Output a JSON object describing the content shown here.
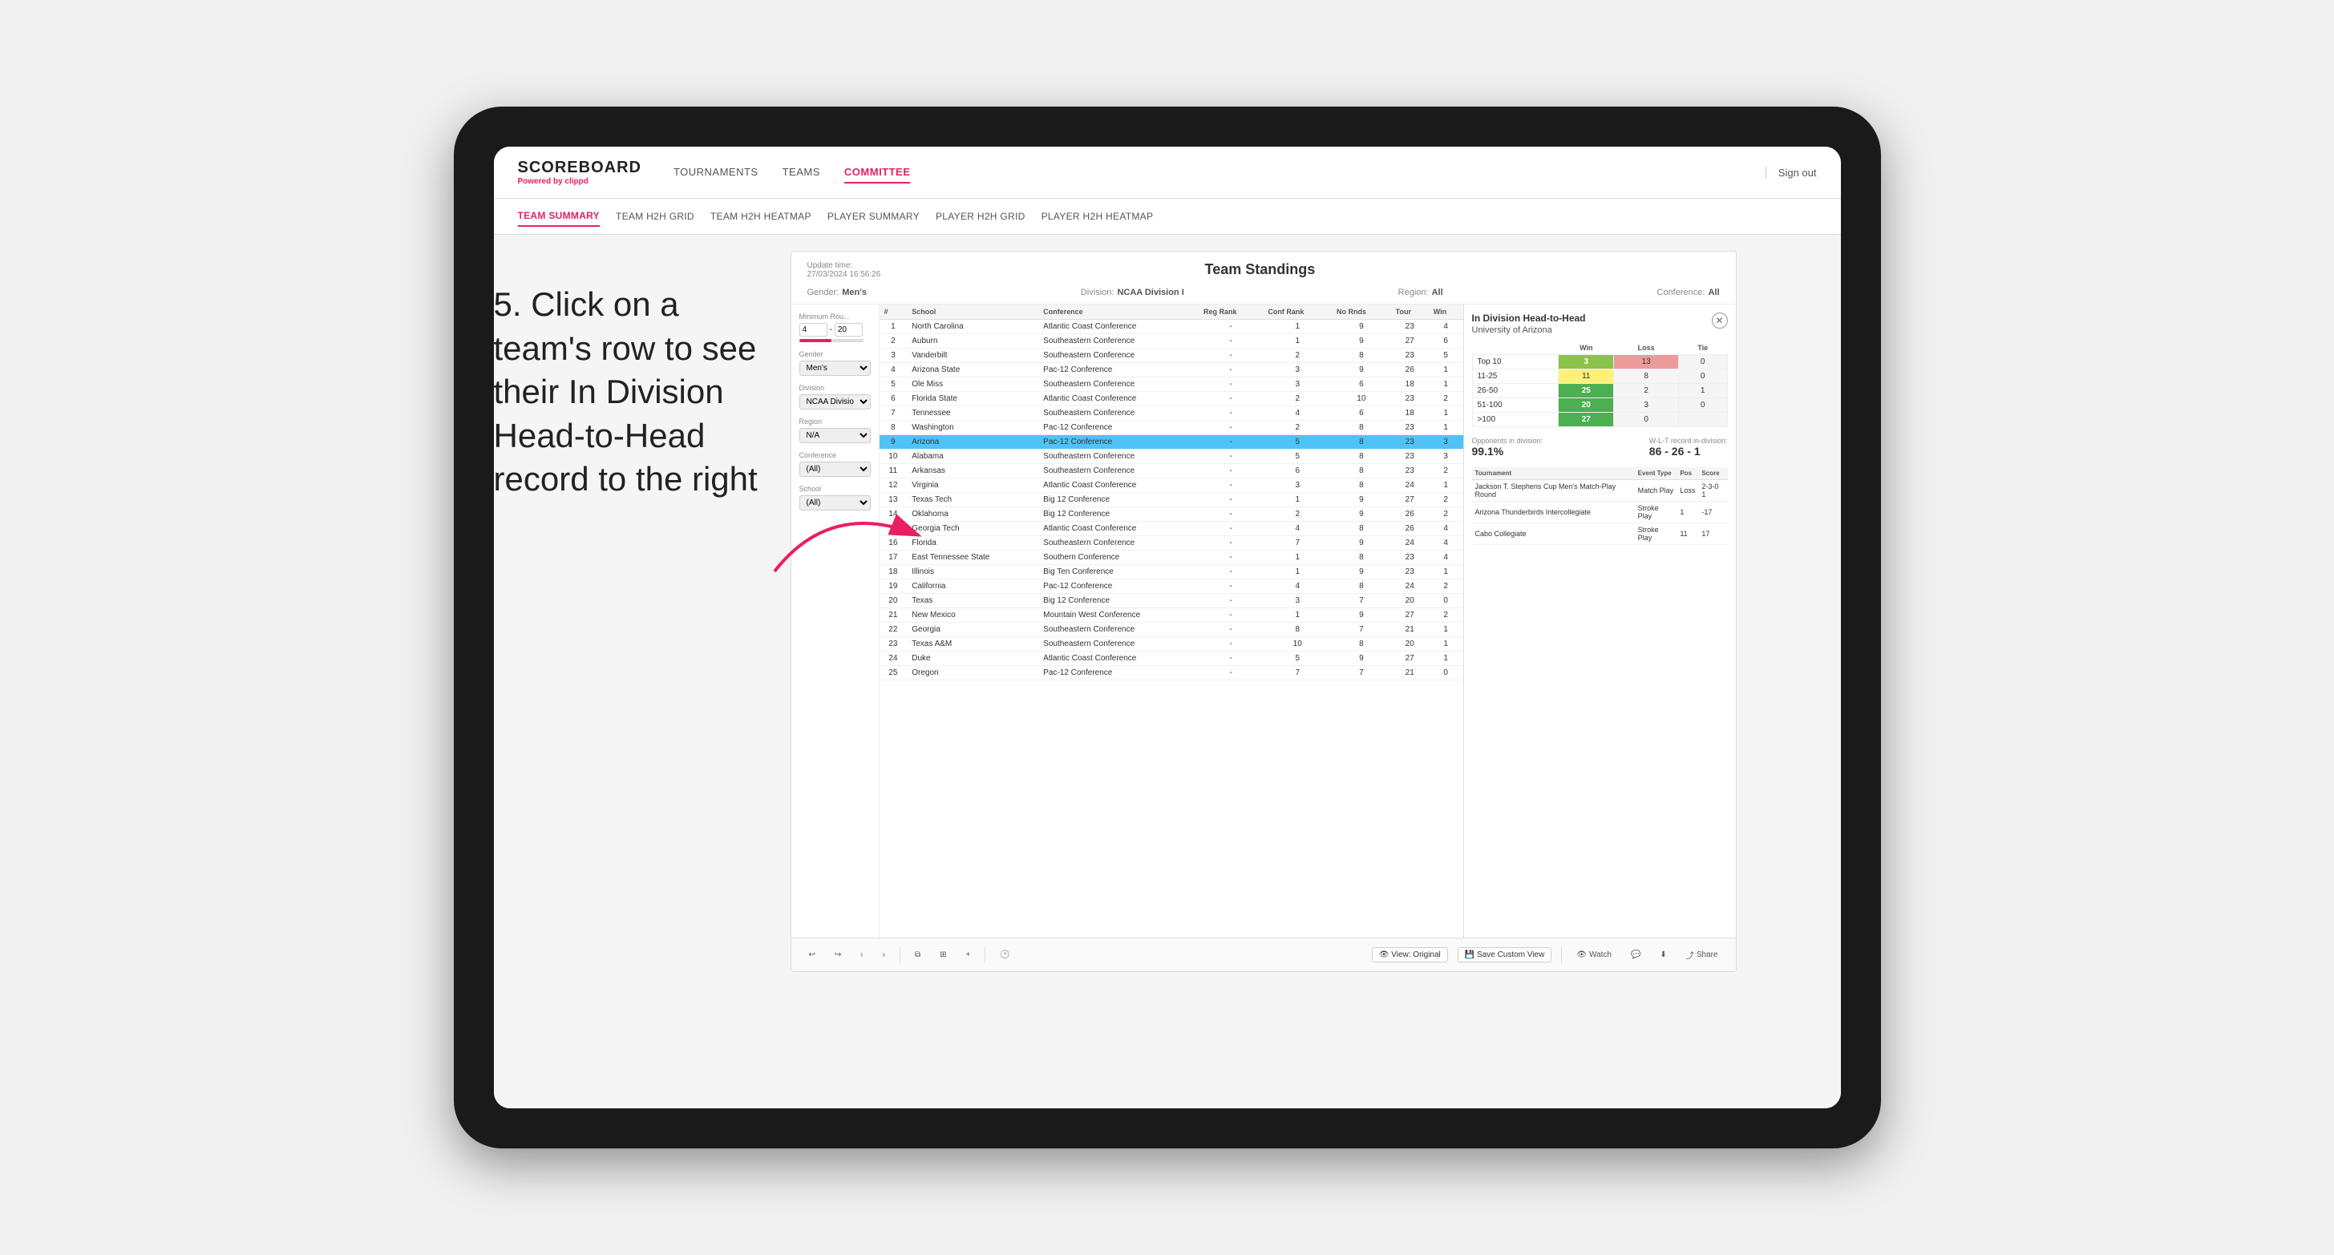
{
  "page": {
    "bg_color": "#e8e8e8"
  },
  "nav": {
    "logo": "SCOREBOARD",
    "logo_sub": "Powered by",
    "logo_brand": "clippd",
    "items": [
      {
        "label": "TOURNAMENTS",
        "active": false
      },
      {
        "label": "TEAMS",
        "active": false
      },
      {
        "label": "COMMITTEE",
        "active": true
      }
    ],
    "sign_out": "Sign out"
  },
  "sub_nav": {
    "items": [
      {
        "label": "TEAM SUMMARY",
        "active": true
      },
      {
        "label": "TEAM H2H GRID",
        "active": false
      },
      {
        "label": "TEAM H2H HEATMAP",
        "active": false
      },
      {
        "label": "PLAYER SUMMARY",
        "active": false
      },
      {
        "label": "PLAYER H2H GRID",
        "active": false
      },
      {
        "label": "PLAYER H2H HEATMAP",
        "active": false
      }
    ]
  },
  "instruction": {
    "text": "5. Click on a team's row to see their In Division Head-to-Head record to the right"
  },
  "dashboard": {
    "update_time_label": "Update time:",
    "update_time": "27/03/2024 16:56:26",
    "title": "Team Standings",
    "meta": {
      "gender_label": "Gender:",
      "gender": "Men's",
      "division_label": "Division:",
      "division": "NCAA Division I",
      "region_label": "Region:",
      "region": "All",
      "conference_label": "Conference:",
      "conference": "All"
    },
    "filters": {
      "min_rounds_label": "Minimum Rou...",
      "min_rounds_value": "4",
      "min_rounds_max": "20",
      "gender_label": "Gender",
      "gender_value": "Men's",
      "division_label": "Division",
      "division_value": "NCAA Division I",
      "region_label": "Region",
      "region_value": "N/A",
      "conference_label": "Conference",
      "conference_value": "(All)",
      "school_label": "School",
      "school_value": "(All)"
    },
    "table": {
      "headers": [
        "#",
        "School",
        "Conference",
        "Reg Rank",
        "Conf Rank",
        "No Rnds",
        "Tour",
        "Win"
      ],
      "rows": [
        {
          "num": "1",
          "school": "North Carolina",
          "conference": "Atlantic Coast Conference",
          "reg_rank": "-",
          "conf_rank": "1",
          "no_rnds": "9",
          "tour": "23",
          "win": "4"
        },
        {
          "num": "2",
          "school": "Auburn",
          "conference": "Southeastern Conference",
          "reg_rank": "-",
          "conf_rank": "1",
          "no_rnds": "9",
          "tour": "27",
          "win": "6"
        },
        {
          "num": "3",
          "school": "Vanderbilt",
          "conference": "Southeastern Conference",
          "reg_rank": "-",
          "conf_rank": "2",
          "no_rnds": "8",
          "tour": "23",
          "win": "5"
        },
        {
          "num": "4",
          "school": "Arizona State",
          "conference": "Pac-12 Conference",
          "reg_rank": "-",
          "conf_rank": "3",
          "no_rnds": "9",
          "tour": "26",
          "win": "1"
        },
        {
          "num": "5",
          "school": "Ole Miss",
          "conference": "Southeastern Conference",
          "reg_rank": "-",
          "conf_rank": "3",
          "no_rnds": "6",
          "tour": "18",
          "win": "1"
        },
        {
          "num": "6",
          "school": "Florida State",
          "conference": "Atlantic Coast Conference",
          "reg_rank": "-",
          "conf_rank": "2",
          "no_rnds": "10",
          "tour": "23",
          "win": "2"
        },
        {
          "num": "7",
          "school": "Tennessee",
          "conference": "Southeastern Conference",
          "reg_rank": "-",
          "conf_rank": "4",
          "no_rnds": "6",
          "tour": "18",
          "win": "1"
        },
        {
          "num": "8",
          "school": "Washington",
          "conference": "Pac-12 Conference",
          "reg_rank": "-",
          "conf_rank": "2",
          "no_rnds": "8",
          "tour": "23",
          "win": "1"
        },
        {
          "num": "9",
          "school": "Arizona",
          "conference": "Pac-12 Conference",
          "reg_rank": "-",
          "conf_rank": "5",
          "no_rnds": "8",
          "tour": "23",
          "win": "3",
          "selected": true
        },
        {
          "num": "10",
          "school": "Alabama",
          "conference": "Southeastern Conference",
          "reg_rank": "-",
          "conf_rank": "5",
          "no_rnds": "8",
          "tour": "23",
          "win": "3"
        },
        {
          "num": "11",
          "school": "Arkansas",
          "conference": "Southeastern Conference",
          "reg_rank": "-",
          "conf_rank": "6",
          "no_rnds": "8",
          "tour": "23",
          "win": "2"
        },
        {
          "num": "12",
          "school": "Virginia",
          "conference": "Atlantic Coast Conference",
          "reg_rank": "-",
          "conf_rank": "3",
          "no_rnds": "8",
          "tour": "24",
          "win": "1"
        },
        {
          "num": "13",
          "school": "Texas Tech",
          "conference": "Big 12 Conference",
          "reg_rank": "-",
          "conf_rank": "1",
          "no_rnds": "9",
          "tour": "27",
          "win": "2"
        },
        {
          "num": "14",
          "school": "Oklahoma",
          "conference": "Big 12 Conference",
          "reg_rank": "-",
          "conf_rank": "2",
          "no_rnds": "9",
          "tour": "26",
          "win": "2"
        },
        {
          "num": "15",
          "school": "Georgia Tech",
          "conference": "Atlantic Coast Conference",
          "reg_rank": "-",
          "conf_rank": "4",
          "no_rnds": "8",
          "tour": "26",
          "win": "4"
        },
        {
          "num": "16",
          "school": "Florida",
          "conference": "Southeastern Conference",
          "reg_rank": "-",
          "conf_rank": "7",
          "no_rnds": "9",
          "tour": "24",
          "win": "4"
        },
        {
          "num": "17",
          "school": "East Tennessee State",
          "conference": "Southern Conference",
          "reg_rank": "-",
          "conf_rank": "1",
          "no_rnds": "8",
          "tour": "23",
          "win": "4"
        },
        {
          "num": "18",
          "school": "Illinois",
          "conference": "Big Ten Conference",
          "reg_rank": "-",
          "conf_rank": "1",
          "no_rnds": "9",
          "tour": "23",
          "win": "1"
        },
        {
          "num": "19",
          "school": "California",
          "conference": "Pac-12 Conference",
          "reg_rank": "-",
          "conf_rank": "4",
          "no_rnds": "8",
          "tour": "24",
          "win": "2"
        },
        {
          "num": "20",
          "school": "Texas",
          "conference": "Big 12 Conference",
          "reg_rank": "-",
          "conf_rank": "3",
          "no_rnds": "7",
          "tour": "20",
          "win": "0"
        },
        {
          "num": "21",
          "school": "New Mexico",
          "conference": "Mountain West Conference",
          "reg_rank": "-",
          "conf_rank": "1",
          "no_rnds": "9",
          "tour": "27",
          "win": "2"
        },
        {
          "num": "22",
          "school": "Georgia",
          "conference": "Southeastern Conference",
          "reg_rank": "-",
          "conf_rank": "8",
          "no_rnds": "7",
          "tour": "21",
          "win": "1"
        },
        {
          "num": "23",
          "school": "Texas A&M",
          "conference": "Southeastern Conference",
          "reg_rank": "-",
          "conf_rank": "10",
          "no_rnds": "8",
          "tour": "20",
          "win": "1"
        },
        {
          "num": "24",
          "school": "Duke",
          "conference": "Atlantic Coast Conference",
          "reg_rank": "-",
          "conf_rank": "5",
          "no_rnds": "9",
          "tour": "27",
          "win": "1"
        },
        {
          "num": "25",
          "school": "Oregon",
          "conference": "Pac-12 Conference",
          "reg_rank": "-",
          "conf_rank": "7",
          "no_rnds": "7",
          "tour": "21",
          "win": "0"
        }
      ]
    },
    "h2h": {
      "title": "In Division Head-to-Head",
      "school": "University of Arizona",
      "table_headers": [
        "",
        "Win",
        "Loss",
        "Tie"
      ],
      "rows": [
        {
          "range": "Top 10",
          "win": "3",
          "loss": "13",
          "tie": "0",
          "win_class": "cell-green",
          "loss_class": "cell-red"
        },
        {
          "range": "11-25",
          "win": "11",
          "loss": "8",
          "tie": "0",
          "win_class": "cell-yellow",
          "loss_class": "cell-gray"
        },
        {
          "range": "26-50",
          "win": "25",
          "loss": "2",
          "tie": "1",
          "win_class": "cell-dark-green",
          "loss_class": "cell-gray"
        },
        {
          "range": "51-100",
          "win": "20",
          "loss": "3",
          "tie": "0",
          "win_class": "cell-dark-green",
          "loss_class": "cell-gray"
        },
        {
          "range": ">100",
          "win": "27",
          "loss": "0",
          "tie": "",
          "win_class": "cell-dark-green",
          "loss_class": "cell-gray"
        }
      ],
      "opponents_label": "Opponents in division:",
      "opponents_value": "99.1%",
      "record_label": "W-L-T record in-division:",
      "record_value": "86 - 26 - 1",
      "tournament_headers": [
        "Tournament",
        "Event Type",
        "Pos",
        "Score"
      ],
      "tournaments": [
        {
          "name": "Jackson T. Stephens Cup Men's Match-Play Round",
          "event_type": "Match Play",
          "pos": "Loss",
          "score": "2-3-0 1"
        },
        {
          "name": "Arizona Thunderbirds Intercollegiate",
          "event_type": "Stroke Play",
          "pos": "1",
          "score": "-17"
        },
        {
          "name": "Cabo Collegiate",
          "event_type": "Stroke Play",
          "pos": "11",
          "score": "17"
        }
      ]
    },
    "toolbar": {
      "undo": "↩",
      "redo_left": "←",
      "redo_right": "→",
      "copy": "⧉",
      "paste": "⌃V",
      "history": "🕐",
      "view_original": "View: Original",
      "save_custom": "Save Custom View",
      "watch": "Watch",
      "comment": "💬",
      "download": "⬇",
      "share": "Share"
    }
  }
}
